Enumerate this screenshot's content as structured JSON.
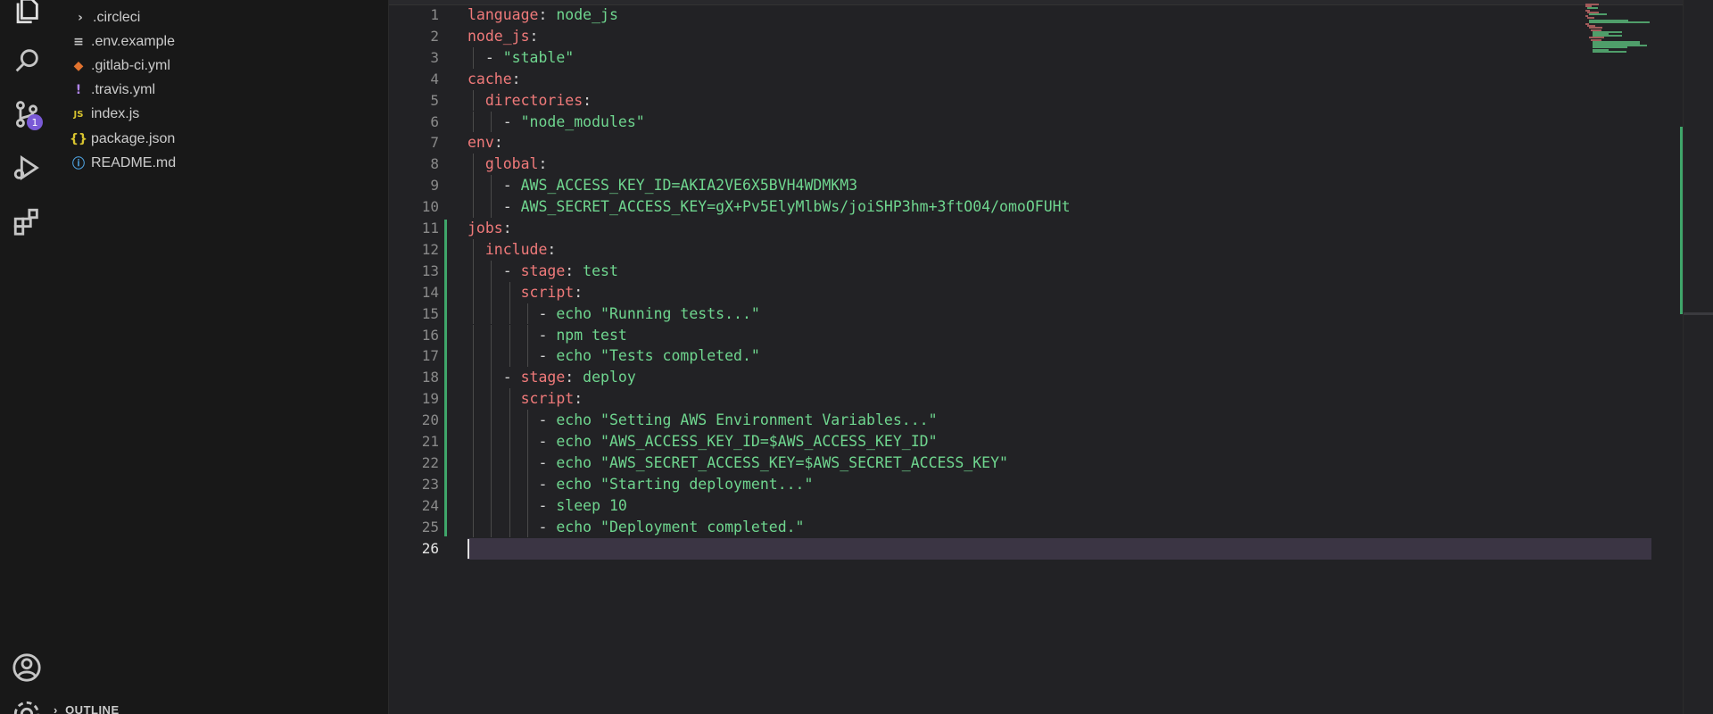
{
  "activity_bar": {
    "items": [
      {
        "icon": "explorer-icon",
        "active": true
      },
      {
        "icon": "search-icon"
      },
      {
        "icon": "source-control-icon",
        "badge": "1"
      },
      {
        "icon": "run-debug-icon"
      },
      {
        "icon": "extensions-icon"
      }
    ],
    "bottom": [
      {
        "icon": "account-icon"
      },
      {
        "icon": "manage-gear-icon"
      }
    ]
  },
  "explorer": {
    "files": [
      {
        "name": ".circleci",
        "icon": "chevron-right-icon",
        "glyph": "›",
        "color": "#c5c5c5"
      },
      {
        "name": ".env.example",
        "icon": "lines-file-icon",
        "glyph": "≡",
        "color": "#c5c5c5"
      },
      {
        "name": ".gitlab-ci.yml",
        "icon": "gitlab-fox-icon",
        "glyph": "◆",
        "color": "#e2732f"
      },
      {
        "name": ".travis.yml",
        "icon": "exclamation-icon",
        "glyph": "!",
        "color": "#b084eb"
      },
      {
        "name": "index.js",
        "icon": "js-file-icon",
        "glyph": "JS",
        "color": "#d8c42f"
      },
      {
        "name": "package.json",
        "icon": "braces-file-icon",
        "glyph": "{}",
        "color": "#d8c42f"
      },
      {
        "name": "README.md",
        "icon": "info-icon",
        "glyph": "ⓘ",
        "color": "#4fa3e0"
      }
    ],
    "outline_label": "OUTLINE"
  },
  "editor": {
    "current_line": 26,
    "lines": [
      {
        "n": 1,
        "indent": 0,
        "dash": false,
        "key": "language",
        "val": "node_js"
      },
      {
        "n": 2,
        "indent": 0,
        "dash": false,
        "key": "node_js",
        "val": ""
      },
      {
        "n": 3,
        "indent": 1,
        "dash": true,
        "key": "",
        "val": "\"stable\""
      },
      {
        "n": 4,
        "indent": 0,
        "dash": false,
        "key": "cache",
        "val": ""
      },
      {
        "n": 5,
        "indent": 1,
        "dash": false,
        "key": "directories",
        "val": ""
      },
      {
        "n": 6,
        "indent": 2,
        "dash": true,
        "key": "",
        "val": "\"node_modules\""
      },
      {
        "n": 7,
        "indent": 0,
        "dash": false,
        "key": "env",
        "val": ""
      },
      {
        "n": 8,
        "indent": 1,
        "dash": false,
        "key": "global",
        "val": ""
      },
      {
        "n": 9,
        "indent": 2,
        "dash": true,
        "key": "",
        "val": "AWS_ACCESS_KEY_ID=AKIA2VE6X5BVH4WDMKM3"
      },
      {
        "n": 10,
        "indent": 2,
        "dash": true,
        "key": "",
        "val": "AWS_SECRET_ACCESS_KEY=gX+Pv5ElyMlbWs/joiSHP3hm+3ftO04/omoOFUHt"
      },
      {
        "n": 11,
        "indent": 0,
        "dash": false,
        "key": "jobs",
        "val": ""
      },
      {
        "n": 12,
        "indent": 1,
        "dash": false,
        "key": "include",
        "val": ""
      },
      {
        "n": 13,
        "indent": 2,
        "dash": true,
        "key": "stage",
        "val": "test"
      },
      {
        "n": 14,
        "indent": 3,
        "dash": false,
        "key": "script",
        "val": ""
      },
      {
        "n": 15,
        "indent": 4,
        "dash": true,
        "key": "",
        "val": "echo \"Running tests...\""
      },
      {
        "n": 16,
        "indent": 4,
        "dash": true,
        "key": "",
        "val": "npm test"
      },
      {
        "n": 17,
        "indent": 4,
        "dash": true,
        "key": "",
        "val": "echo \"Tests completed.\""
      },
      {
        "n": 18,
        "indent": 2,
        "dash": true,
        "key": "stage",
        "val": "deploy"
      },
      {
        "n": 19,
        "indent": 3,
        "dash": false,
        "key": "script",
        "val": ""
      },
      {
        "n": 20,
        "indent": 4,
        "dash": true,
        "key": "",
        "val": "echo \"Setting AWS Environment Variables...\""
      },
      {
        "n": 21,
        "indent": 4,
        "dash": true,
        "key": "",
        "val": "echo \"AWS_ACCESS_KEY_ID=$AWS_ACCESS_KEY_ID\""
      },
      {
        "n": 22,
        "indent": 4,
        "dash": true,
        "key": "",
        "val": "echo \"AWS_SECRET_ACCESS_KEY=$AWS_SECRET_ACCESS_KEY\""
      },
      {
        "n": 23,
        "indent": 4,
        "dash": true,
        "key": "",
        "val": "echo \"Starting deployment...\""
      },
      {
        "n": 24,
        "indent": 4,
        "dash": true,
        "key": "",
        "val": "sleep 10"
      },
      {
        "n": 25,
        "indent": 4,
        "dash": true,
        "key": "",
        "val": "echo \"Deployment completed.\""
      },
      {
        "n": 26,
        "indent": 0,
        "dash": false,
        "key": "",
        "val": ""
      }
    ],
    "modified_ranges": [
      [
        11,
        25
      ]
    ],
    "colors": {
      "key": "#f07a7a",
      "value": "#6fd68f",
      "line_number": "#8a8a8a",
      "modified_gutter": "#3fa56a",
      "current_line_bg": "#3b3544",
      "badge": "#7a5ad6"
    }
  }
}
